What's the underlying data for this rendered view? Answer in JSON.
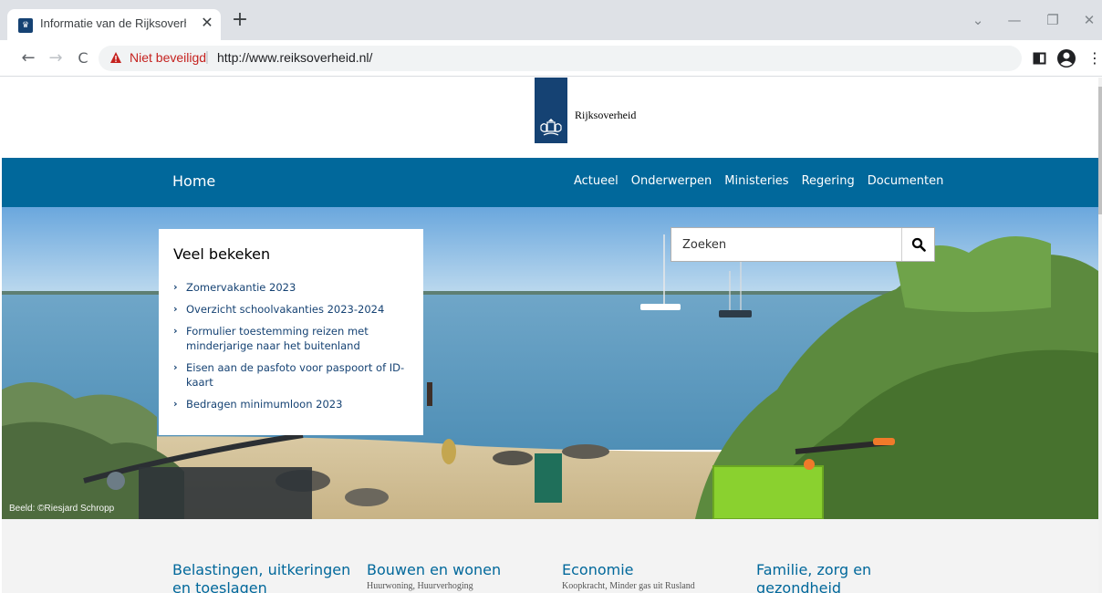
{
  "browser": {
    "tab_title": "Informatie van de Rijksoverheid |",
    "tab_close": "✕",
    "new_tab": "+",
    "not_secure_label": "Niet beveiligd",
    "omnibox_separator": "|",
    "url": "http://www.reiksoverheid.nl/",
    "nav_back": "←",
    "nav_forward": "→",
    "nav_reload": "C",
    "win_chevron": "⌄",
    "win_minimize": "—",
    "win_restore": "❐",
    "win_close": "✕",
    "menu_dots": "⋮",
    "colors": {
      "tabstrip": "#dee1e6",
      "warning": "#c5221f"
    }
  },
  "site": {
    "logo_text": "Rijksoverheid",
    "nav_home": "Home",
    "nav_links": [
      "Actueel",
      "Onderwerpen",
      "Ministeries",
      "Regering",
      "Documenten"
    ],
    "colors": {
      "brand": "#154273",
      "nav": "#01689b"
    },
    "search": {
      "placeholder": "Zoeken"
    },
    "popular": {
      "title": "Veel bekeken",
      "items": [
        "Zomervakantie 2023",
        "Overzicht schoolvakanties 2023-2024",
        "Formulier toestemming reizen met minderjarige naar het buitenland",
        "Eisen aan de pasfoto voor paspoort of ID-kaart",
        "Bedragen minimumloon 2023"
      ]
    },
    "image_credit": "Beeld: ©Riesjard Schropp",
    "topics": [
      {
        "title": "Belastingen, uitkeringen en toeslagen",
        "sub": ""
      },
      {
        "title": "Bouwen en wonen",
        "sub": "Huurwoning, Huurverhoging"
      },
      {
        "title": "Economie",
        "sub": "Koopkracht, Minder gas uit Rusland"
      },
      {
        "title": "Familie, zorg en gezondheid",
        "sub": ""
      }
    ]
  }
}
